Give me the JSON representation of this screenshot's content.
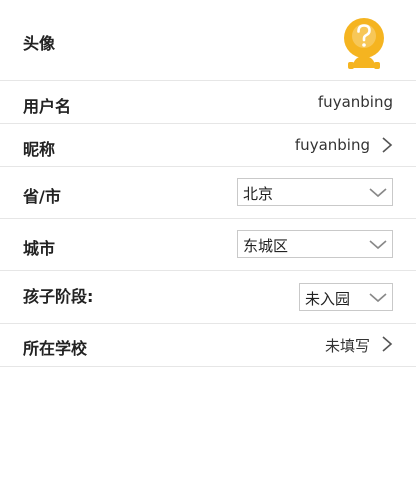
{
  "profile": {
    "avatar": {
      "label": "头像",
      "icon": "question-avatar-icon",
      "color": "#f5b420"
    },
    "username": {
      "label": "用户名",
      "value": "fuyanbing"
    },
    "nickname": {
      "label": "昵称",
      "value": "fuyanbing"
    },
    "province": {
      "label": "省/市",
      "selected": "北京"
    },
    "city": {
      "label": "城市",
      "selected": "东城区"
    },
    "stage": {
      "label": "孩子阶段:",
      "selected": "未入园"
    },
    "school": {
      "label": "所在学校",
      "value": "未填写"
    }
  }
}
